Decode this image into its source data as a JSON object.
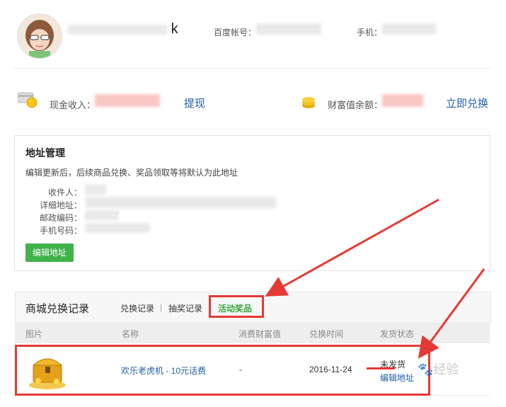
{
  "profile": {
    "username_visible": "k",
    "baidu_account_label": "百度帐号：",
    "phone_label": "手机："
  },
  "balance": {
    "cash_income_label": "现金收入：",
    "withdraw_link": "提现",
    "wealth_balance_label": "财富值余额：",
    "redeem_link": "立即兑换"
  },
  "address": {
    "title": "地址管理",
    "note": "编辑更新后，后续商品兑换、奖品领取等将默认为此地址",
    "fields": [
      {
        "label": "收件人："
      },
      {
        "label": "详细地址："
      },
      {
        "label": "邮政编码："
      },
      {
        "label": "手机号码："
      }
    ],
    "edit_button": "编辑地址"
  },
  "records": {
    "title": "商城兑换记录",
    "tabs": [
      {
        "label": "兑换记录",
        "active": false
      },
      {
        "label": "抽奖记录",
        "active": false
      },
      {
        "label": "活动奖品",
        "active": true
      }
    ],
    "tab_separator": "|",
    "columns": [
      "图片",
      "名称",
      "消费财富值",
      "兑换时间",
      "发货状态"
    ],
    "rows": [
      {
        "image_icon": "treasure-chest-icon",
        "name": "欢乐老虎机 - 10元话费",
        "cost": "-",
        "date": "2016-11-24",
        "status": "未发货",
        "action": "编辑地址"
      }
    ]
  },
  "watermark": {
    "text": "经验"
  },
  "colors": {
    "accent_green": "#3fb24a",
    "link_blue": "#1f5fa8",
    "annotation_red": "#e53935"
  }
}
